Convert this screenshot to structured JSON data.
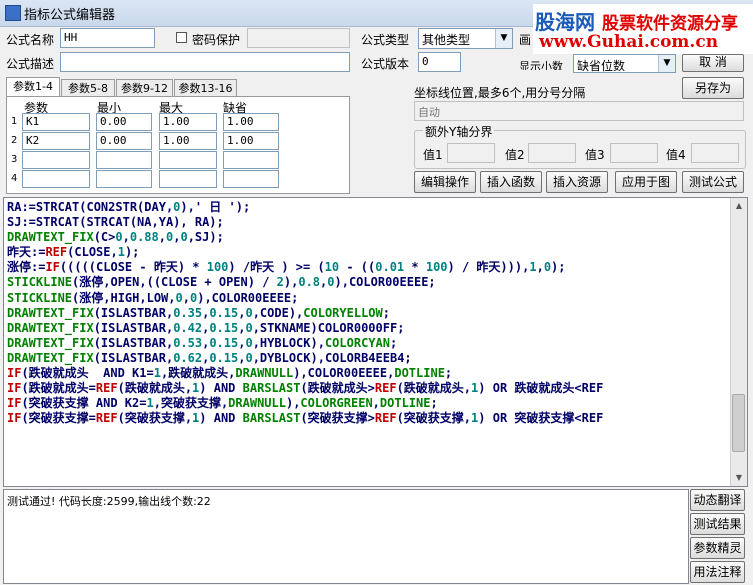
{
  "window": {
    "title": "指标公式编辑器"
  },
  "watermark": {
    "brand": "股海网",
    "slogan": "股票软件资源分享",
    "url": "www.Guhai.com.cn"
  },
  "form": {
    "name_label": "公式名称",
    "name_value": "HH",
    "password_label": "密码保护",
    "type_label": "公式类型",
    "type_value": "其他类型",
    "draw_label": "画",
    "desc_label": "公式描述",
    "desc_value": "",
    "version_label": "公式版本",
    "version_value": "0",
    "display_label": "显示小数",
    "display_value": "缺省位数"
  },
  "buttons": {
    "cancel": "取 消",
    "save_as": "另存为",
    "edit_ops": "编辑操作",
    "insert_func": "插入函数",
    "insert_res": "插入资源",
    "apply": "应用于图",
    "test": "测试公式",
    "dyn_translate": "动态翻译",
    "test_result": "测试结果",
    "param_guide": "参数精灵",
    "usage_note": "用法注释"
  },
  "params": {
    "tabs": [
      "参数1-4",
      "参数5-8",
      "参数9-12",
      "参数13-16"
    ],
    "headers": [
      "参数",
      "最小",
      "最大",
      "缺省"
    ],
    "rows": [
      {
        "n": "1",
        "name": "K1",
        "min": "0.00",
        "max": "1.00",
        "def": "1.00"
      },
      {
        "n": "2",
        "name": "K2",
        "min": "0.00",
        "max": "1.00",
        "def": "1.00"
      },
      {
        "n": "3",
        "name": "",
        "min": "",
        "max": "",
        "def": ""
      },
      {
        "n": "4",
        "name": "",
        "min": "",
        "max": "",
        "def": ""
      }
    ]
  },
  "axis": {
    "label": "坐标线位置,最多6个,用分号分隔",
    "placeholder": "自动"
  },
  "extra_y": {
    "title": "额外Y轴分界",
    "labels": [
      "值1",
      "值2",
      "值3",
      "值4"
    ]
  },
  "code_lines": [
    [
      [
        "#000066",
        "RA:=STRCAT(CON2STR(DAY,"
      ],
      [
        "#008080",
        "0"
      ],
      [
        "#000066",
        "),' 日 ');"
      ]
    ],
    [
      [
        "#000066",
        "SJ:=STRCAT(STRCAT(NA,YA), RA);"
      ]
    ],
    [
      [
        "#008000",
        "DRAWTEXT_FIX"
      ],
      [
        "#000066",
        "(C>"
      ],
      [
        "#008080",
        "0"
      ],
      [
        "#000066",
        ","
      ],
      [
        "#008080",
        "0.88"
      ],
      [
        "#000066",
        ","
      ],
      [
        "#008080",
        "0"
      ],
      [
        "#000066",
        ","
      ],
      [
        "#008080",
        "0"
      ],
      [
        "#000066",
        ",SJ);"
      ]
    ],
    [
      [
        "#000066",
        "昨天:="
      ],
      [
        "#c00000",
        "REF"
      ],
      [
        "#000066",
        "(CLOSE,"
      ],
      [
        "#008080",
        "1"
      ],
      [
        "#000066",
        ");"
      ]
    ],
    [
      [
        "#000066",
        "涨停:="
      ],
      [
        "#c00000",
        "IF"
      ],
      [
        "#000066",
        "(((((CLOSE - 昨天) * "
      ],
      [
        "#008080",
        "100"
      ],
      [
        "#000066",
        ") /昨天 ) >= ("
      ],
      [
        "#008080",
        "10"
      ],
      [
        "#000066",
        " - (("
      ],
      [
        "#008080",
        "0.01"
      ],
      [
        "#000066",
        " * "
      ],
      [
        "#008080",
        "100"
      ],
      [
        "#000066",
        ") / 昨天))),"
      ],
      [
        "#008080",
        "1"
      ],
      [
        "#000066",
        ","
      ],
      [
        "#008080",
        "0"
      ],
      [
        "#000066",
        ");"
      ]
    ],
    [
      [
        "#008000",
        "STICKLINE"
      ],
      [
        "#000066",
        "(涨停,OPEN,((CLOSE + OPEN) / "
      ],
      [
        "#008080",
        "2"
      ],
      [
        "#000066",
        "),"
      ],
      [
        "#008080",
        "0.8"
      ],
      [
        "#000066",
        ","
      ],
      [
        "#008080",
        "0"
      ],
      [
        "#000066",
        "),COLOR00EEEE;"
      ]
    ],
    [
      [
        "#008000",
        "STICKLINE"
      ],
      [
        "#000066",
        "(涨停,HIGH,LOW,"
      ],
      [
        "#008080",
        "0"
      ],
      [
        "#000066",
        ","
      ],
      [
        "#008080",
        "0"
      ],
      [
        "#000066",
        "),COLOR00EEEE;"
      ]
    ],
    [
      [
        "#008000",
        "DRAWTEXT_FIX"
      ],
      [
        "#000066",
        "(ISLASTBAR,"
      ],
      [
        "#008080",
        "0.35"
      ],
      [
        "#000066",
        ","
      ],
      [
        "#008080",
        "0.15"
      ],
      [
        "#000066",
        ","
      ],
      [
        "#008080",
        "0"
      ],
      [
        "#000066",
        ",CODE),"
      ],
      [
        "#008000",
        "COLORYELLOW"
      ],
      [
        "#000066",
        ";"
      ]
    ],
    [
      [
        "#008000",
        "DRAWTEXT_FIX"
      ],
      [
        "#000066",
        "(ISLASTBAR,"
      ],
      [
        "#008080",
        "0.42"
      ],
      [
        "#000066",
        ","
      ],
      [
        "#008080",
        "0.15"
      ],
      [
        "#000066",
        ","
      ],
      [
        "#008080",
        "0"
      ],
      [
        "#000066",
        ",STKNAME)COLOR0000FF;"
      ]
    ],
    [
      [
        "#008000",
        "DRAWTEXT_FIX"
      ],
      [
        "#000066",
        "(ISLASTBAR,"
      ],
      [
        "#008080",
        "0.53"
      ],
      [
        "#000066",
        ","
      ],
      [
        "#008080",
        "0.15"
      ],
      [
        "#000066",
        ","
      ],
      [
        "#008080",
        "0"
      ],
      [
        "#000066",
        ",HYBLOCK),"
      ],
      [
        "#008000",
        "COLORCYAN"
      ],
      [
        "#000066",
        ";"
      ]
    ],
    [
      [
        "#008000",
        "DRAWTEXT_FIX"
      ],
      [
        "#000066",
        "(ISLASTBAR,"
      ],
      [
        "#008080",
        "0.62"
      ],
      [
        "#000066",
        ","
      ],
      [
        "#008080",
        "0.15"
      ],
      [
        "#000066",
        ","
      ],
      [
        "#008080",
        "0"
      ],
      [
        "#000066",
        ",DYBLOCK),COLORB4EEB4;"
      ]
    ],
    [
      [
        "#c00000",
        "IF"
      ],
      [
        "#000066",
        "(跌破就成头  AND K1="
      ],
      [
        "#008080",
        "1"
      ],
      [
        "#000066",
        ",跌破就成头,"
      ],
      [
        "#008000",
        "DRAWNULL"
      ],
      [
        "#000066",
        "),COLOR00EEEE,"
      ],
      [
        "#008000",
        "DOTLINE"
      ],
      [
        "#000066",
        ";"
      ]
    ],
    [
      [
        "#c00000",
        "IF"
      ],
      [
        "#000066",
        "(跌破就成头="
      ],
      [
        "#c00000",
        "REF"
      ],
      [
        "#000066",
        "(跌破就成头,"
      ],
      [
        "#008080",
        "1"
      ],
      [
        "#000066",
        ") AND "
      ],
      [
        "#008000",
        "BARSLAST"
      ],
      [
        "#000066",
        "(跌破就成头>"
      ],
      [
        "#c00000",
        "REF"
      ],
      [
        "#000066",
        "(跌破就成头,"
      ],
      [
        "#008080",
        "1"
      ],
      [
        "#000066",
        ") OR 跌破就成头<REF"
      ]
    ],
    [
      [
        "#c00000",
        "IF"
      ],
      [
        "#000066",
        "(突破获支撑 AND K2="
      ],
      [
        "#008080",
        "1"
      ],
      [
        "#000066",
        ",突破获支撑,"
      ],
      [
        "#008000",
        "DRAWNULL"
      ],
      [
        "#000066",
        "),"
      ],
      [
        "#008000",
        "COLORGREEN"
      ],
      [
        "#000066",
        ","
      ],
      [
        "#008000",
        "DOTLINE"
      ],
      [
        "#000066",
        ";"
      ]
    ],
    [
      [
        "#c00000",
        "IF"
      ],
      [
        "#000066",
        "(突破获支撑="
      ],
      [
        "#c00000",
        "REF"
      ],
      [
        "#000066",
        "(突破获支撑,"
      ],
      [
        "#008080",
        "1"
      ],
      [
        "#000066",
        ") AND "
      ],
      [
        "#008000",
        "BARSLAST"
      ],
      [
        "#000066",
        "(突破获支撑>"
      ],
      [
        "#c00000",
        "REF"
      ],
      [
        "#000066",
        "(突破获支撑,"
      ],
      [
        "#008080",
        "1"
      ],
      [
        "#000066",
        ") OR 突破获支撑<REF"
      ]
    ]
  ],
  "output": {
    "text": "测试通过! 代码长度:2599,输出线个数:22"
  }
}
